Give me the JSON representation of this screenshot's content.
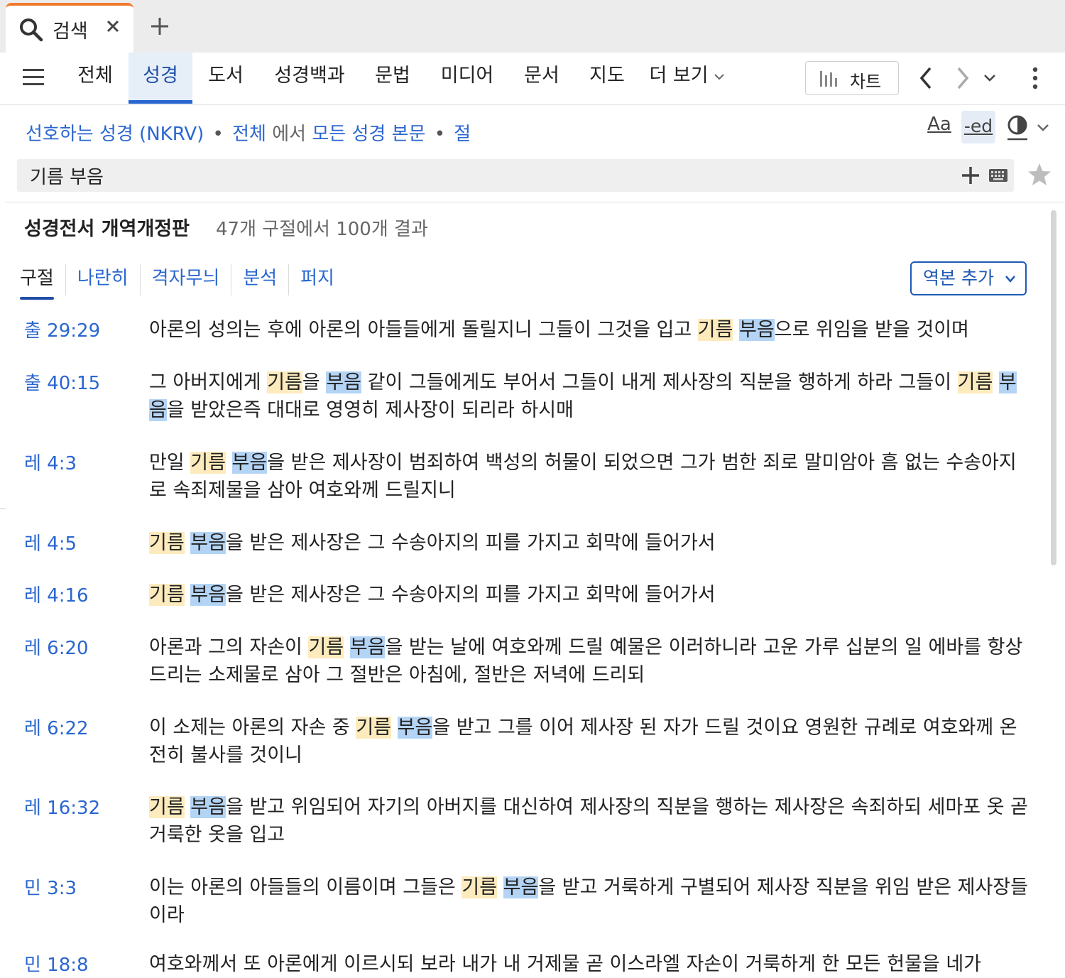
{
  "tab": {
    "title": "검색"
  },
  "nav": {
    "tabs": [
      "전체",
      "성경",
      "도서",
      "성경백과",
      "문법",
      "미디어",
      "문서",
      "지도",
      "더 보기"
    ],
    "chart_label": "차트"
  },
  "scope": {
    "preferred": "선호하는 성경 (NKRV)",
    "all": "전체",
    "in": "에서",
    "texts": "모든 성경 본문",
    "unit": "절",
    "sep": "•"
  },
  "toolbar": {
    "aa": "Aa",
    "ed": "-ed"
  },
  "search": {
    "query": "기름 부음"
  },
  "results": {
    "title": "성경전서 개역개정판",
    "count": "47개 구절에서 100개 결과",
    "view_tabs": [
      "구절",
      "나란히",
      "격자무늬",
      "분석",
      "퍼지"
    ],
    "add_version": "역본 추가",
    "rows": [
      {
        "ref": "출 29:29",
        "segs": [
          [
            "아론의 성의는 후에 아론의 아들들에게 돌릴지니 그들이 그것을 입고 ",
            ""
          ],
          [
            "기름",
            "y"
          ],
          [
            " ",
            ""
          ],
          [
            "부음",
            "b"
          ],
          [
            "으로 위임을 받을 것이며",
            ""
          ]
        ]
      },
      {
        "ref": "출 40:15",
        "segs": [
          [
            "그 아버지에게 ",
            ""
          ],
          [
            "기름",
            "y"
          ],
          [
            "을 ",
            ""
          ],
          [
            "부음",
            "b"
          ],
          [
            " 같이 그들에게도 부어서 그들이 내게 제사장의 직분을 행하게 하라 그들이 ",
            ""
          ],
          [
            "기름",
            "y"
          ],
          [
            " ",
            ""
          ],
          [
            "부음",
            "b"
          ],
          [
            "을 받았은즉 대대로 영영히 제사장이 되리라 하시매",
            ""
          ]
        ]
      },
      {
        "ref": "레 4:3",
        "segs": [
          [
            "만일 ",
            ""
          ],
          [
            "기름",
            "y"
          ],
          [
            " ",
            ""
          ],
          [
            "부음",
            "b"
          ],
          [
            "을 받은 제사장이 범죄하여 백성의 허물이 되었으면 그가 범한 죄로 말미암아 흠 없는 수송아지로 속죄제물을 삼아 여호와께 드릴지니",
            ""
          ]
        ]
      },
      {
        "ref": "레 4:5",
        "segs": [
          [
            "기름",
            "y"
          ],
          [
            " ",
            ""
          ],
          [
            "부음",
            "b"
          ],
          [
            "을 받은 제사장은 그 수송아지의 피를 가지고 회막에 들어가서",
            ""
          ]
        ]
      },
      {
        "ref": "레 4:16",
        "segs": [
          [
            "기름",
            "y"
          ],
          [
            " ",
            ""
          ],
          [
            "부음",
            "b"
          ],
          [
            "을 받은 제사장은 그 수송아지의 피를 가지고 회막에 들어가서",
            ""
          ]
        ]
      },
      {
        "ref": "레 6:20",
        "segs": [
          [
            "아론과 그의 자손이 ",
            ""
          ],
          [
            "기름",
            "y"
          ],
          [
            " ",
            ""
          ],
          [
            "부음",
            "b"
          ],
          [
            "을 받는 날에 여호와께 드릴 예물은 이러하니라 고운 가루 십분의 일 에바를 항상 드리는 소제물로 삼아 그 절반은 아침에, 절반은 저녁에 드리되",
            ""
          ]
        ]
      },
      {
        "ref": "레 6:22",
        "segs": [
          [
            "이 소제는 아론의 자손 중 ",
            ""
          ],
          [
            "기름",
            "y"
          ],
          [
            " ",
            ""
          ],
          [
            "부음",
            "b"
          ],
          [
            "을 받고 그를 이어 제사장 된 자가 드릴 것이요 영원한 규례로 여호와께 온전히 불사를 것이니",
            ""
          ]
        ]
      },
      {
        "ref": "레 16:32",
        "segs": [
          [
            "기름",
            "y"
          ],
          [
            " ",
            ""
          ],
          [
            "부음",
            "b"
          ],
          [
            "을 받고 위임되어 자기의 아버지를 대신하여 제사장의 직분을 행하는 제사장은 속죄하되 세마포 옷 곧 거룩한 옷을 입고",
            ""
          ]
        ]
      },
      {
        "ref": "민 3:3",
        "segs": [
          [
            "이는 아론의 아들들의 이름이며 그들은 ",
            ""
          ],
          [
            "기름",
            "y"
          ],
          [
            " ",
            ""
          ],
          [
            "부음",
            "b"
          ],
          [
            "을 받고 거룩하게 구별되어 제사장 직분을 위임 받은 제사장들이라",
            ""
          ]
        ]
      },
      {
        "ref": "민 18:8",
        "segs": [
          [
            "여호와께서 또 아론에게 이르시되 보라 내가 내 거제물 곧 이스라엘 자손이 거룩하게 한 모든 헌물을 네가",
            ""
          ]
        ]
      }
    ]
  }
}
